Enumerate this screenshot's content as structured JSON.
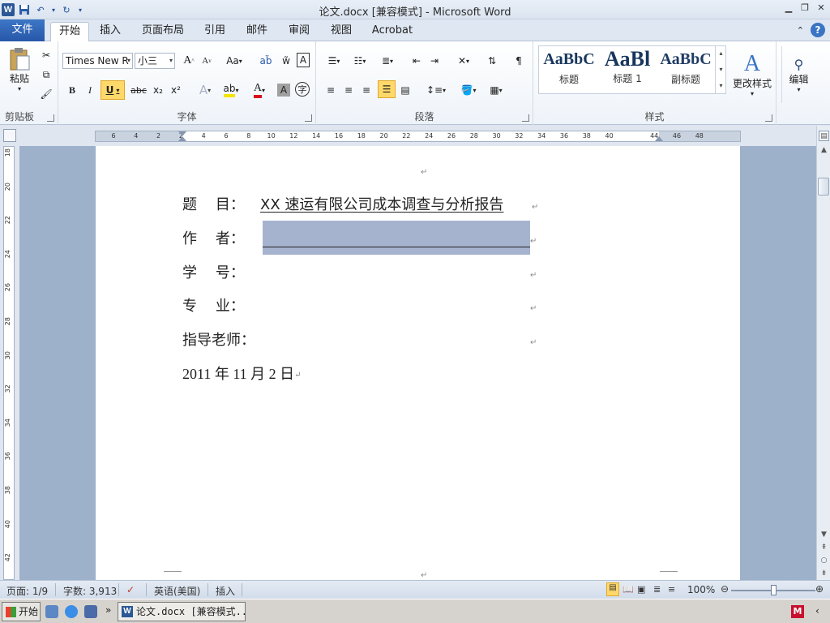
{
  "window": {
    "title": "论文.docx [兼容模式] - Microsoft Word",
    "app_icon": "W"
  },
  "tabs": [
    {
      "label": "文件"
    },
    {
      "label": "开始"
    },
    {
      "label": "插入"
    },
    {
      "label": "页面布局"
    },
    {
      "label": "引用"
    },
    {
      "label": "邮件"
    },
    {
      "label": "审阅"
    },
    {
      "label": "视图"
    },
    {
      "label": "Acrobat"
    }
  ],
  "ribbon": {
    "clipboard": {
      "paste_label": "粘贴",
      "group_label": "剪贴板"
    },
    "font": {
      "font_name": "Times New R",
      "font_size": "小三",
      "group_label": "字体",
      "grow": "A",
      "shrink": "A",
      "case": "Aa",
      "bold": "B",
      "italic": "I",
      "underline": "U",
      "strike": "abc",
      "subscript": "x₂",
      "superscript": "x²"
    },
    "paragraph": {
      "group_label": "段落"
    },
    "styles": {
      "group_label": "样式",
      "items": [
        {
          "sample": "AaBbC",
          "name": "标题"
        },
        {
          "sample": "AaBl",
          "name": "标题 1"
        },
        {
          "sample": "AaBbC",
          "name": "副标题"
        }
      ],
      "change_styles_label": "更改样式"
    },
    "editing": {
      "label": "编辑"
    }
  },
  "ruler": {
    "h_ticks": [
      "6",
      "4",
      "2",
      "2",
      "4",
      "6",
      "8",
      "10",
      "12",
      "14",
      "16",
      "18",
      "20",
      "22",
      "24",
      "26",
      "28",
      "30",
      "32",
      "34",
      "36",
      "38",
      "40",
      "44",
      "46",
      "48"
    ],
    "v_ticks": [
      "18",
      "20",
      "22",
      "24",
      "26",
      "28",
      "30",
      "32",
      "34",
      "36",
      "38",
      "40",
      "42"
    ]
  },
  "document": {
    "lines": [
      {
        "label": "题    目：",
        "value": "XX 速运有限公司成本调查与分析报告"
      },
      {
        "label": "作    者：",
        "value": ""
      },
      {
        "label": "学    号：",
        "value": ""
      },
      {
        "label": "专    业：",
        "value": ""
      },
      {
        "label": "指导老师：",
        "value": ""
      }
    ],
    "date_line": "2011 年 11 月 2 日",
    "para_mark": "↵"
  },
  "statusbar": {
    "page": "页面: 1/9",
    "words": "字数: 3,913",
    "language": "英语(美国)",
    "mode": "插入",
    "zoom": "100%"
  },
  "taskbar": {
    "start_label": "开始",
    "word_task": "论文.docx [兼容模式..."
  },
  "colors": {
    "file_tab": "#2b5797",
    "selection": "#a6b3cf",
    "doc_background": "#9eb1cb"
  }
}
